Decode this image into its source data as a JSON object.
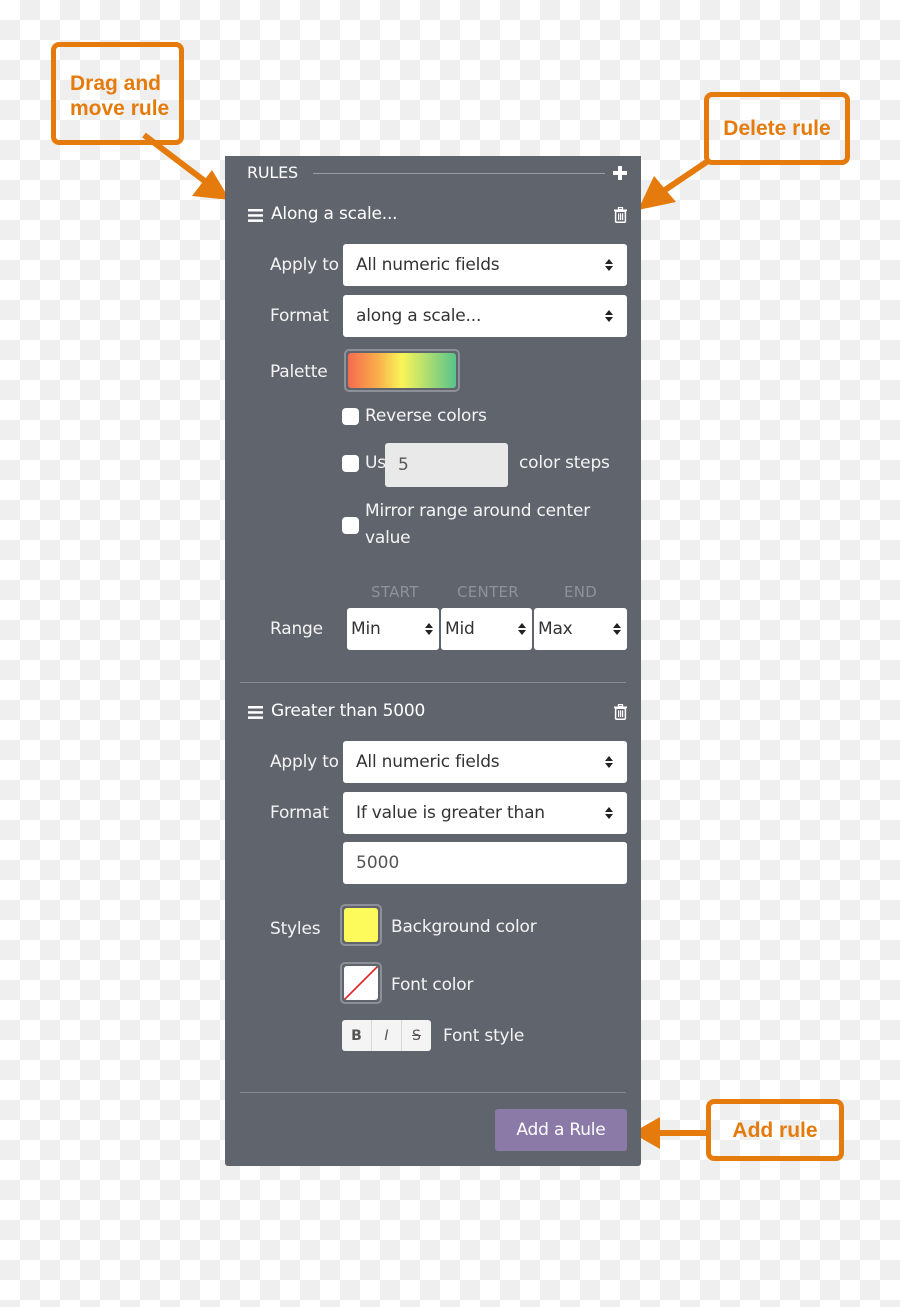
{
  "callouts": {
    "drag": "Drag and move rule",
    "drag_line1": "Drag and",
    "drag_line2": "move rule",
    "delete": "Delete rule",
    "add": "Add rule"
  },
  "colors": {
    "annotation_orange": "#e57b0c",
    "panel_bg": "#60646d",
    "add_button": "#8b7aa8",
    "background_swatch": "#fdfb5c",
    "font_color_none_slash": "#e21c1c"
  },
  "panel": {
    "header": "RULES",
    "add_icon": "plus-icon",
    "rules": [
      {
        "title": "Along a scale...",
        "drag_icon": "hamburger-icon",
        "delete_icon": "trash-icon",
        "apply_to_label": "Apply to",
        "apply_to_value": "All numeric fields",
        "format_label": "Format",
        "format_value": "along a scale...",
        "palette_label": "Palette",
        "palette_colors": [
          "#f56a4f",
          "#f9b04b",
          "#f9f558",
          "#b3df70",
          "#58c48a"
        ],
        "reverse_colors": {
          "label": "Reverse colors",
          "checked": false
        },
        "use_steps": {
          "label_before": "Use",
          "value": "5",
          "label_after": "color steps",
          "checked": false
        },
        "mirror_range": {
          "label": "Mirror range around center value",
          "line1": "Mirror range around center",
          "line2": "value",
          "checked": false
        },
        "range_label": "Range",
        "range_headers": [
          "START",
          "CENTER",
          "END"
        ],
        "range_values": [
          "Min",
          "Mid",
          "Max"
        ]
      },
      {
        "title": "Greater than 5000",
        "drag_icon": "hamburger-icon",
        "delete_icon": "trash-icon",
        "apply_to_label": "Apply to",
        "apply_to_value": "All numeric fields",
        "format_label": "Format",
        "format_value": "If value is greater than",
        "threshold_value": "5000",
        "styles_label": "Styles",
        "background_color_label": "Background color",
        "font_color_label": "Font color",
        "font_style_label": "Font style",
        "font_style_buttons": [
          "B",
          "I",
          "S"
        ]
      }
    ],
    "add_rule_button": "Add a Rule"
  }
}
